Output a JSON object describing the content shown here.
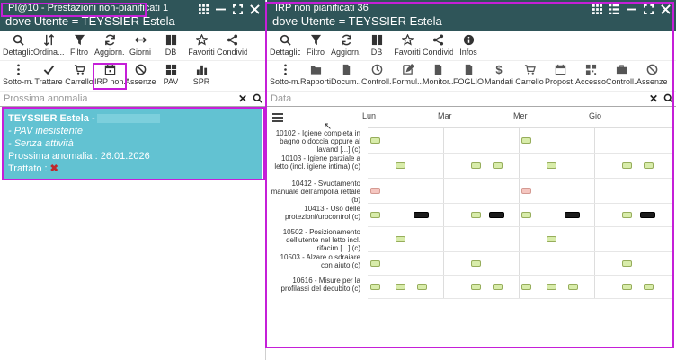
{
  "left_panel": {
    "title": "PI@10 - Prestazioni non-pianificati 1",
    "subtitle": "dove Utente = TEYSSIER Estela",
    "toolbar1": [
      {
        "label": "Dettaglio",
        "icon": "search-icon"
      },
      {
        "label": "Ordina...",
        "icon": "sort-icon"
      },
      {
        "label": "Filtro",
        "icon": "filter-icon"
      },
      {
        "label": "Aggiorn...",
        "icon": "refresh-icon"
      },
      {
        "label": "Giorni",
        "icon": "arrows-horizontal-icon"
      },
      {
        "label": "DB",
        "icon": "grid-icon"
      },
      {
        "label": "Favoriti",
        "icon": "star-icon"
      },
      {
        "label": "Condivid",
        "icon": "share-icon"
      }
    ],
    "toolbar2": [
      {
        "label": "Sotto-m...",
        "icon": "more-vertical-icon"
      },
      {
        "label": "Trattare",
        "icon": "check-icon"
      },
      {
        "label": "Carrello",
        "icon": "cart-icon"
      },
      {
        "label": "IRP non...",
        "icon": "calendar-icon"
      },
      {
        "label": "Assenze",
        "icon": "ban-icon"
      },
      {
        "label": "PAV",
        "icon": "grid-icon"
      },
      {
        "label": "SPR",
        "icon": "bar-chart-icon"
      }
    ],
    "search_placeholder": "Prossima anomalia",
    "card": {
      "name": "TEYSSIER Estela",
      "name_suffix": "-",
      "line1": "- PAV inesistente",
      "line2": "- Senza attività",
      "line3": "Prossima anomalia : 26.01.2026",
      "line4": "Trattato :",
      "treated_icon": "red-x-icon"
    }
  },
  "right_panel": {
    "title": "IRP non pianificati 36",
    "subtitle": "dove Utente = TEYSSIER Estela",
    "toolbar1": [
      {
        "label": "Dettaglio",
        "icon": "search-icon"
      },
      {
        "label": "Filtro",
        "icon": "filter-icon"
      },
      {
        "label": "Aggiorn...",
        "icon": "refresh-icon"
      },
      {
        "label": "DB",
        "icon": "grid-icon"
      },
      {
        "label": "Favoriti",
        "icon": "star-icon"
      },
      {
        "label": "Condividi",
        "icon": "share-icon"
      },
      {
        "label": "Infos",
        "icon": "info-icon"
      }
    ],
    "toolbar2": [
      {
        "label": "Sotto-m...",
        "icon": "more-vertical-icon"
      },
      {
        "label": "Rapporti",
        "icon": "folder-icon"
      },
      {
        "label": "Docum...",
        "icon": "document-icon"
      },
      {
        "label": "Controll...",
        "icon": "clock-icon"
      },
      {
        "label": "Formul...",
        "icon": "edit-icon"
      },
      {
        "label": "Monitor...",
        "icon": "document-icon"
      },
      {
        "label": "FOGLIO...",
        "icon": "document-icon"
      },
      {
        "label": "Mandati",
        "icon": "dollar-icon"
      },
      {
        "label": "Carrello",
        "icon": "cart-icon"
      },
      {
        "label": "Propost...",
        "icon": "calendar-icon"
      },
      {
        "label": "Accesso...",
        "icon": "qr-icon"
      },
      {
        "label": "Controll...",
        "icon": "briefcase-icon"
      },
      {
        "label": "Assenze",
        "icon": "ban-icon"
      }
    ],
    "search_placeholder": "Data",
    "days": [
      "Lun",
      "Mar",
      "Mer",
      "Gio"
    ],
    "rows": [
      {
        "label": "10102 - Igiene completa in bagno o doccia oppure al lavand [...] (c)",
        "marks": [
          {
            "c": "g",
            "s": 0.04
          },
          {
            "c": "g",
            "s": 2.04
          }
        ]
      },
      {
        "label": "10103 - Igiene parziale a letto (incl. igiene intima) (c)",
        "marks": [
          {
            "c": "g",
            "s": 0.37
          },
          {
            "c": "g",
            "s": 1.37
          },
          {
            "c": "g",
            "s": 1.65
          },
          {
            "c": "g",
            "s": 2.37
          },
          {
            "c": "g",
            "s": 3.37
          },
          {
            "c": "g",
            "s": 3.65
          }
        ]
      },
      {
        "label": "10412 - Svuotamento manuale dell'ampolla rettale (b)",
        "marks": [
          {
            "c": "p",
            "s": 0.04
          },
          {
            "c": "p",
            "s": 2.04
          }
        ]
      },
      {
        "label": "10413 - Uso delle protezioni/urocontrol (c)",
        "marks": [
          {
            "c": "g",
            "s": 0.04
          },
          {
            "c": "b",
            "s": 0.66
          },
          {
            "c": "g",
            "s": 1.37
          },
          {
            "c": "b",
            "s": 1.66
          },
          {
            "c": "g",
            "s": 2.04
          },
          {
            "c": "b",
            "s": 2.66
          },
          {
            "c": "g",
            "s": 3.37
          },
          {
            "c": "b",
            "s": 3.66
          }
        ]
      },
      {
        "label": "10502 - Posizionamento dell'utente nel letto incl. rifacim [...] (c)",
        "marks": [
          {
            "c": "g",
            "s": 0.37
          },
          {
            "c": "g",
            "s": 2.37
          }
        ]
      },
      {
        "label": "10503 - Alzare o sdraiare con aiuto (c)",
        "marks": [
          {
            "c": "g",
            "s": 0.04
          },
          {
            "c": "g",
            "s": 1.37
          },
          {
            "c": "g",
            "s": 3.37
          }
        ]
      },
      {
        "label": "10616 - Misure per la profilassi del decubito (c)",
        "marks": [
          {
            "c": "g",
            "s": 0.04
          },
          {
            "c": "g",
            "s": 0.37
          },
          {
            "c": "g",
            "s": 0.66
          },
          {
            "c": "g",
            "s": 1.37
          },
          {
            "c": "g",
            "s": 1.65
          },
          {
            "c": "g",
            "s": 2.04
          },
          {
            "c": "g",
            "s": 2.37
          },
          {
            "c": "g",
            "s": 2.66
          },
          {
            "c": "g",
            "s": 3.37
          },
          {
            "c": "g",
            "s": 3.65
          }
        ]
      }
    ]
  },
  "colors": {
    "header_bg": "#2f5559",
    "card_bg": "#62c2d2",
    "highlight": "#c51fd8",
    "mark_green": "#d8ecaa",
    "mark_pink": "#f5c6c0",
    "mark_black": "#1c1c1c"
  }
}
